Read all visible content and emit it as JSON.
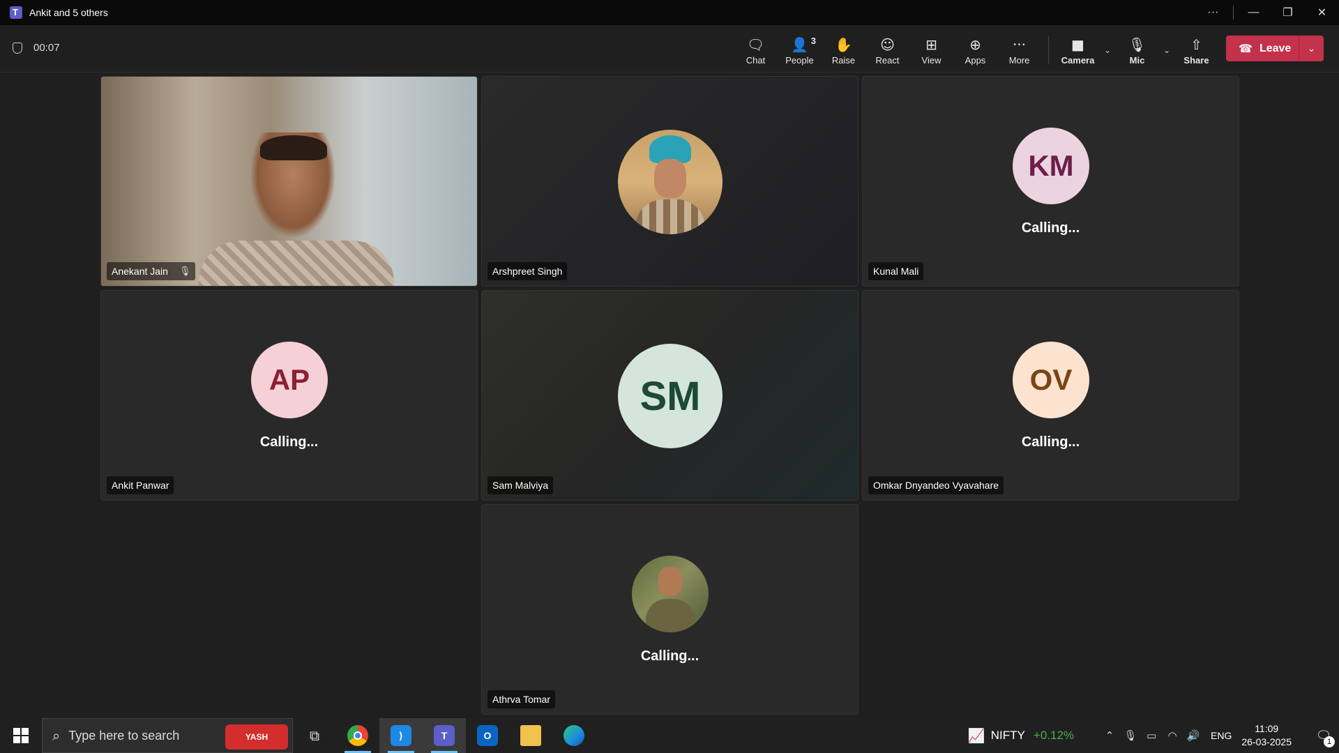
{
  "window": {
    "title": "Ankit and 5 others"
  },
  "meeting": {
    "timer": "00:07",
    "toolbar": {
      "chat": "Chat",
      "people": "People",
      "people_count": "3",
      "raise": "Raise",
      "react": "React",
      "view": "View",
      "apps": "Apps",
      "more": "More",
      "camera": "Camera",
      "mic": "Mic",
      "share": "Share",
      "leave": "Leave"
    },
    "participants": [
      {
        "name": "Anekant Jain",
        "status": "",
        "muted": true
      },
      {
        "name": "Arshpreet Singh",
        "status": ""
      },
      {
        "name": "Kunal Mali",
        "initials": "KM",
        "status": "Calling..."
      },
      {
        "name": "Ankit Panwar",
        "initials": "AP",
        "status": "Calling..."
      },
      {
        "name": "Sam Malviya",
        "initials": "SM",
        "status": ""
      },
      {
        "name": "Omkar Dnyandeo Vyavahare",
        "initials": "OV",
        "status": "Calling..."
      },
      {
        "name": "Athrva Tomar",
        "status": "Calling..."
      }
    ]
  },
  "taskbar": {
    "search_placeholder": "Type here to search",
    "search_badge": "YASH",
    "apps": [
      "task-view",
      "chrome",
      "vscode",
      "teams",
      "outlook",
      "file-explorer",
      "edge"
    ],
    "nifty_label": "NIFTY",
    "nifty_change": "+0.12%",
    "lang": "ENG",
    "time": "11:09",
    "date": "26-03-2025",
    "notification_count": "1"
  },
  "colors": {
    "leave": "#c4314b",
    "avatar_km": "#ecd3e0",
    "avatar_ap": "#f5d0d6",
    "avatar_sm": "#d4e6dc",
    "avatar_ov": "#fbe3cf"
  }
}
